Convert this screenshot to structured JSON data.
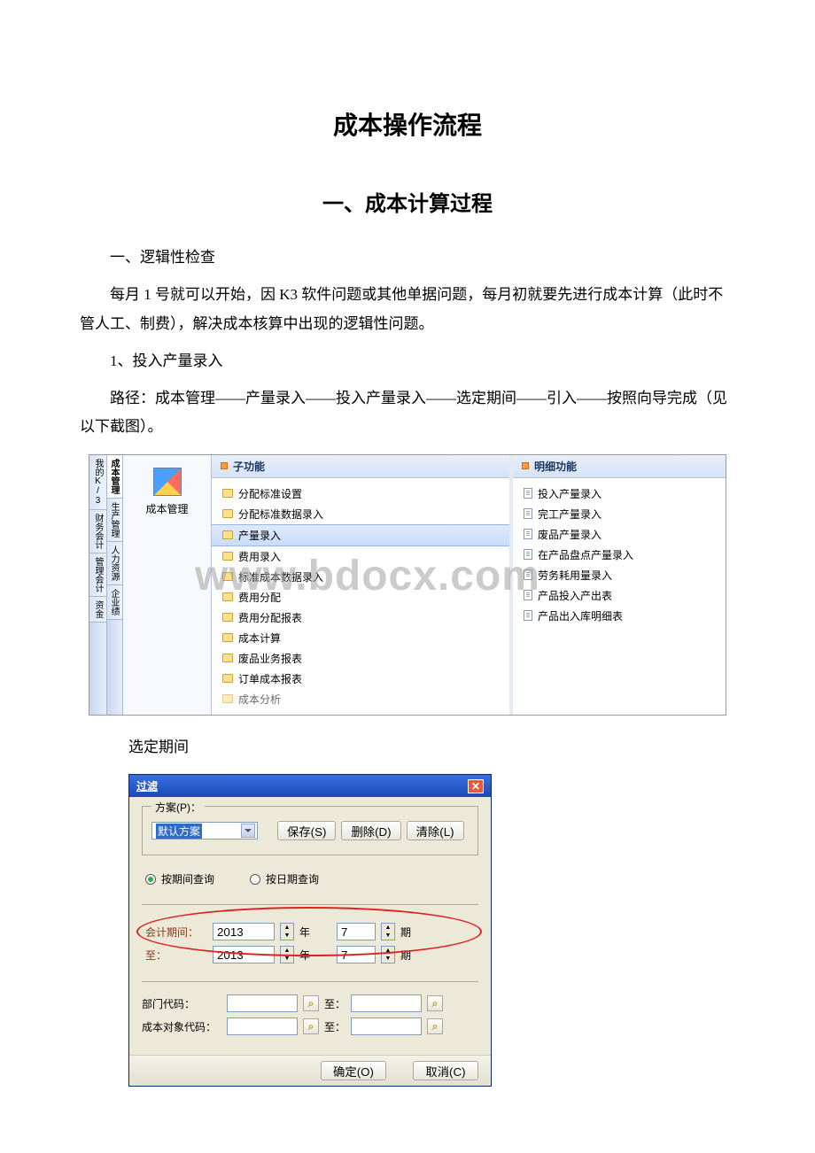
{
  "doc": {
    "title": "成本操作流程",
    "section": "一、成本计算过程",
    "h_logic": "一、逻辑性检查",
    "p_month": "每月 1 号就可以开始，因 K3 软件问题或其他单据问题，每月初就要先进行成本计算（此时不管人工、制费），解决成本核算中出现的逻辑性问题。",
    "p_input": "1、投入产量录入",
    "p_path": "路径：成本管理——产量录入——投入产量录入——选定期间——引入——按照向导完成（见以下截图）。",
    "p_selperiod": "选定期间"
  },
  "k3": {
    "tabs": [
      "成本管理",
      "生产管理",
      "人力资源",
      "企业绩"
    ],
    "side_tabs": [
      "我的K/3",
      "财务会计",
      "管理会计",
      "资金"
    ],
    "nav_label": "成本管理",
    "head_sub": "子功能",
    "head_detail": "明细功能",
    "sub_items": [
      "分配标准设置",
      "分配标准数据录入",
      "产量录入",
      "费用录入",
      "标准成本数据录入",
      "费用分配",
      "费用分配报表",
      "成本计算",
      "废品业务报表",
      "订单成本报表",
      "成本分析"
    ],
    "sub_selected_index": 2,
    "detail_items": [
      "投入产量录入",
      "完工产量录入",
      "废品产量录入",
      "在产品盘点产量录入",
      "劳务耗用量录入",
      "产品投入产出表",
      "产品出入库明细表"
    ]
  },
  "dlg": {
    "title": "过滤",
    "plan_legend": "方案(P)：",
    "plan_default": "默认方案",
    "btn_save": "保存(S)",
    "btn_delete": "删除(D)",
    "btn_clear": "清除(L)",
    "radio_period": "按期间查询",
    "radio_date": "按日期查询",
    "lbl_acctperiod": "会计期间：",
    "lbl_to": "至：",
    "year1": "2013",
    "year2": "2013",
    "period1": "7",
    "period2": "7",
    "unit_year": "年",
    "unit_period": "期",
    "lbl_dept": "部门代码：",
    "lbl_to2": "至：",
    "lbl_costobj": "成本对象代码：",
    "btn_ok": "确定(O)",
    "btn_cancel": "取消(C)"
  },
  "watermark": "www.bdocx.com"
}
